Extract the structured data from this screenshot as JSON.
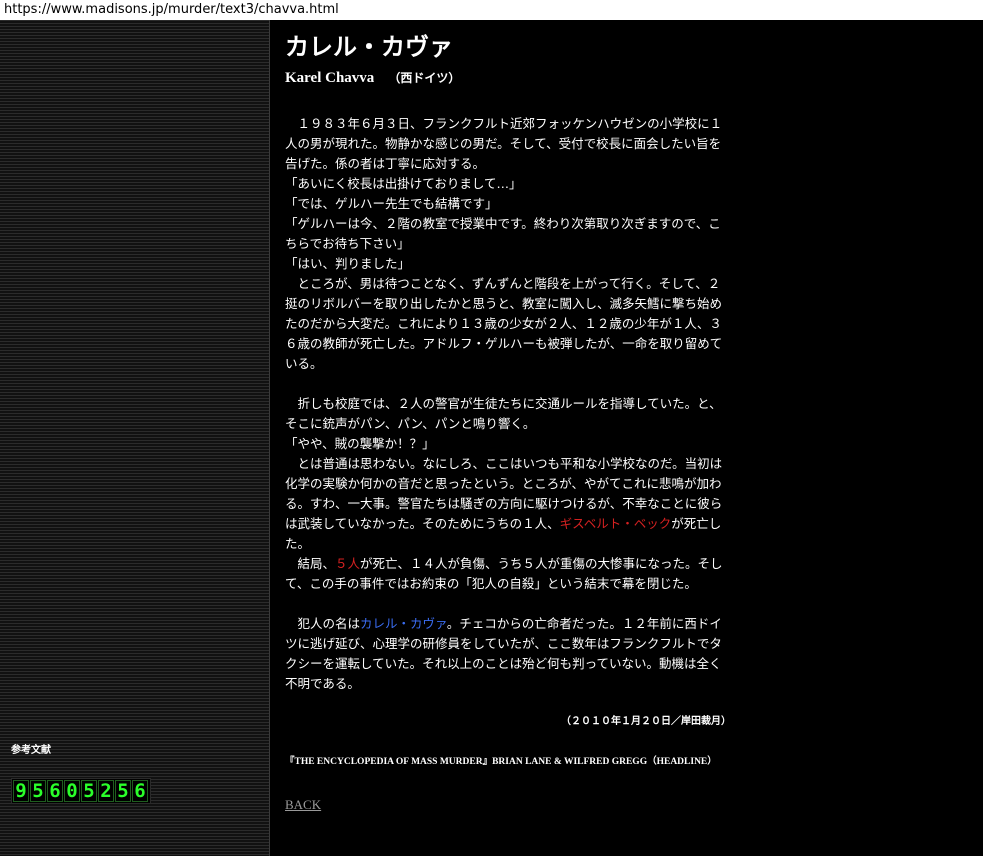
{
  "url": "https://www.madisons.jp/murder/text3/chavva.html",
  "sidebar": {
    "reference_label": "参考文献",
    "counter_digits": [
      "9",
      "5",
      "6",
      "0",
      "5",
      "2",
      "5",
      "6"
    ]
  },
  "article": {
    "title": "カレル・カヴァ",
    "subtitle_name": "Karel Chavva",
    "subtitle_country": "（西ドイツ）",
    "p1_lines": [
      "　１９８３年６月３日、フランクフルト近郊フォッケンハウゼンの小学校に１",
      "人の男が現れた。物静かな感じの男だ。そして、受付で校長に面会したい旨を",
      "告げた。係の者は丁寧に応対する。",
      "「あいにく校長は出掛けておりまして…」",
      "「では、ゲルハー先生でも結構です」",
      "「ゲルハーは今、２階の教室で授業中です。終わり次第取り次ぎますので、こ",
      "ちらでお待ち下さい」",
      "「はい、判りました」",
      "　ところが、男は待つことなく、ずんずんと階段を上がって行く。そして、２",
      "挺のリボルバーを取り出したかと思うと、教室に闖入し、滅多矢鱈に撃ち始め",
      "たのだから大変だ。これにより１３歳の少女が２人、１２歳の少年が１人、３",
      "６歳の教師が死亡した。アドルフ・ゲルハーも被弾したが、一命を取り留めて",
      "いる。"
    ],
    "p2_lines": [
      "　折しも校庭では、２人の警官が生徒たちに交通ルールを指導していた。と、",
      "そこに銃声がパン、パン、パンと鳴り響く。",
      "「やや、賊の襲撃か！？」",
      "　とは普通は思わない。なにしろ、ここはいつも平和な小学校なのだ。当初は",
      "化学の実験か何かの音だと思ったという。ところが、やがてこれに悲鳴が加わ",
      "る。すわ、一大事。警官たちは騒ぎの方向に駆けつけるが、不幸なことに彼ら"
    ],
    "p2_line7_before": "は武装していなかった。そのためにうちの１人、",
    "p2_line7_red": "ギスベルト・ベック",
    "p2_line7_after": "が死亡し",
    "p2_line8": "た。",
    "p2_line9_before": "　結局、",
    "p2_line9_red": "５人",
    "p2_line9_after": "が死亡、１４人が負傷、うち５人が重傷の大惨事になった。そし",
    "p2_line10": "て、この手の事件ではお約束の「犯人の自殺」という結末で幕を閉じた。",
    "p3_line1_before": "　犯人の名は",
    "p3_line1_blue": "カレル・カヴァ",
    "p3_line1_after": "。チェコからの亡命者だった。１２年前に西ドイ",
    "p3_lines": [
      "ツに逃げ延び、心理学の研修員をしていたが、ここ数年はフランクフルトでタ",
      "クシーを運転していた。それ以上のことは殆ど何も判っていない。動機は全く",
      "不明である。"
    ],
    "date_line": "（２０１０年１月２０日／岸田裁月）",
    "reference": "『THE ENCYCLOPEDIA OF MASS MURDER』BRIAN LANE & WILFRED GREGG（HEADLINE）",
    "back_label": "BACK"
  }
}
